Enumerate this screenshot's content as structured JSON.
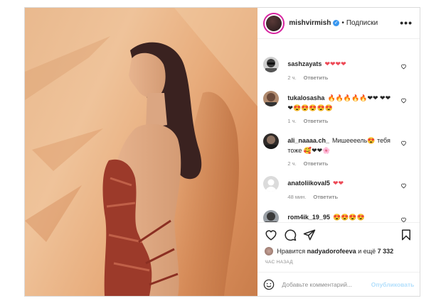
{
  "post": {
    "username": "mishvirmish",
    "dot": "•",
    "follow_label": "Подписки",
    "more_label": "•••"
  },
  "comments": [
    {
      "username": "sashzayats",
      "text": "❤❤❤❤",
      "time": "2 ч.",
      "reply": "Ответить",
      "avatar_icon": "person-sunglasses-icon"
    },
    {
      "username": "tukalosasha",
      "text": "🔥🔥🔥🔥🔥❤❤ ❤❤❤😍😍😍😍😍",
      "time": "1 ч.",
      "reply": "Ответить",
      "avatar_icon": "person-portrait-icon"
    },
    {
      "username": "ali_naaaa.ch_",
      "text": "Мишеееель😍 тебя тоже 🥰❤❤🌸",
      "time": "2 ч.",
      "reply": "Ответить",
      "avatar_icon": "person-portrait-icon"
    },
    {
      "username": "anatoliikoval5",
      "text": "❤❤",
      "time": "48 мин.",
      "reply": "Ответить",
      "avatar_icon": "default-avatar-icon"
    },
    {
      "username": "rom4ik_19_95",
      "text": "😍😍😍😍",
      "time": "",
      "reply": "",
      "avatar_icon": "person-portrait-icon"
    }
  ],
  "likes": {
    "prefix": "Нравится",
    "user": "nadyadorofeeva",
    "suffix": "и ещё",
    "count": "7 332"
  },
  "time_ago": "ЧАС НАЗАД",
  "comment_box": {
    "placeholder": "Добавьте комментарий...",
    "publish_label": "Опубликовать"
  },
  "colors": {
    "heart": "#ed4956",
    "verified": "#3897f0",
    "publish_disabled": "#b2dffc",
    "photo_background": "#e8ad7d"
  }
}
